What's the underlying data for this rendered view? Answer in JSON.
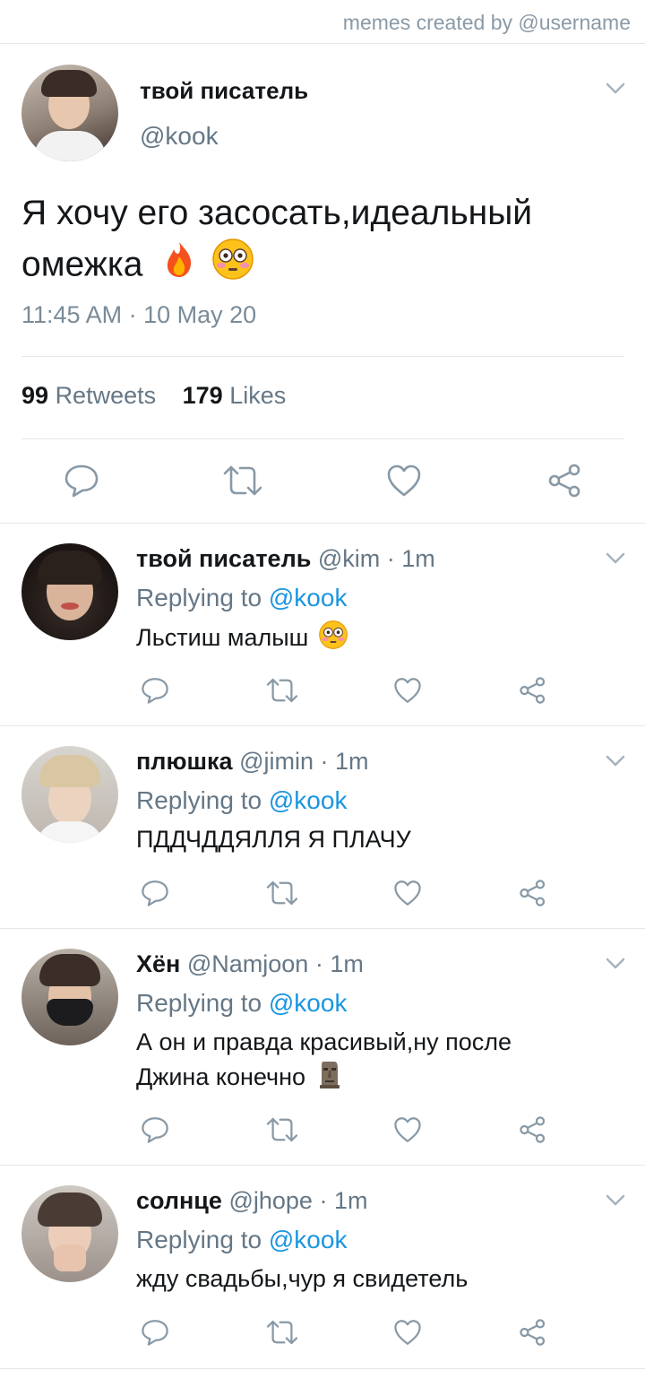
{
  "credit": "memes created by @username",
  "main": {
    "name": "твой писатель",
    "handle": "@kook",
    "text": "Я хочу его засосать,идеальный омежка",
    "emojis": [
      "fire-emoji",
      "flushed-emoji"
    ],
    "timestamp": "11:45 AM · 10 May 20",
    "retweets_count": "99",
    "retweets_label": "Retweets",
    "likes_count": "179",
    "likes_label": "Likes"
  },
  "replies": [
    {
      "name": "твой писатель",
      "handle": "@kim",
      "time": "· 1m",
      "replying_label": "Replying to",
      "replying_to": "@kook",
      "text": "Льстиш малыш",
      "emoji": "flushed-emoji"
    },
    {
      "name": "плюшка",
      "handle": "@jimin",
      "time": "· 1m",
      "replying_label": "Replying to",
      "replying_to": "@kook",
      "text": "ПДДЧДДЯЛЛЯ Я ПЛАЧУ",
      "emoji": ""
    },
    {
      "name": "Хён",
      "handle": "@Namjoon",
      "time": "· 1m",
      "replying_label": "Replying to",
      "replying_to": "@kook",
      "text_line1": "А он и правда красивый,ну после",
      "text_line2": "Джина конечно",
      "emoji": "moai-emoji"
    },
    {
      "name": "солнце",
      "handle": "@jhope",
      "time": "· 1m",
      "replying_label": "Replying to",
      "replying_to": "@kook",
      "text": "жду свадьбы,чур я свидетель",
      "emoji": ""
    }
  ],
  "colors": {
    "link": "#1b95e0",
    "secondary_text": "#657786",
    "icon": "#8899a6",
    "divider": "#e3e7ea"
  },
  "icons": [
    "reply-icon",
    "retweet-icon",
    "like-icon",
    "share-icon",
    "chevron-down-icon"
  ]
}
